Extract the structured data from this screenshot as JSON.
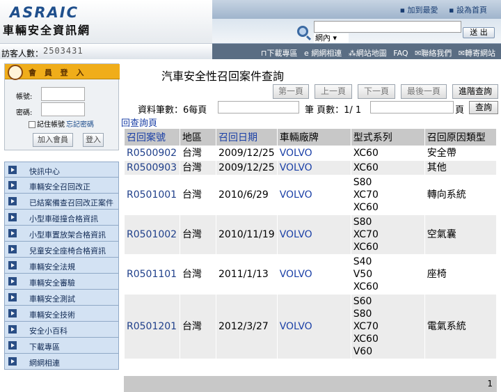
{
  "header": {
    "logo_en": "ASRAIC",
    "logo_zh": "車輛安全資訊網",
    "top_links": [
      "▪ 加到最愛",
      "▪ 設為首頁"
    ],
    "search_scope": "網內 ▾",
    "search_button": "送 出",
    "visitor_label": "訪客人數：",
    "visitor_count": "2503431",
    "nav_links": [
      "⊓下載專區",
      "e 網網相連",
      "⁂網站地圖",
      "FAQ",
      "✉聯絡我們",
      "✉轉寄網站"
    ]
  },
  "login": {
    "title": "會 員 登 入",
    "account_label": "帳號:",
    "password_label": "密碼:",
    "remember": "記住帳號",
    "forgot": "忘記密碼",
    "join_button": "加入會員",
    "login_button": "登入"
  },
  "menu": [
    "快訊中心",
    "車輛安全召回改正",
    "已結案備查召回改正案件",
    "小型車碰撞合格資訊",
    "小型車置放架合格資訊",
    "兒童安全座椅合格資訊",
    "車輛安全法規",
    "車輛安全審驗",
    "車輛安全測試",
    "車輛安全技術",
    "安全小百科",
    "下載專區",
    "網網相連"
  ],
  "main": {
    "title": "汽車安全性召回案件查詢",
    "buttons": {
      "first": "第一頁",
      "prev": "上一頁",
      "next": "下一頁",
      "last": "最後一頁",
      "advanced": "進階查詢"
    },
    "records_label": "資料筆數：6每頁",
    "pages_label": "筆 頁數：1/ 1",
    "page_suffix": "頁",
    "query_button": "查詢",
    "back_link": "回查詢頁",
    "columns": [
      "召回案號",
      "地區",
      "召回日期",
      "車輛廠牌",
      "型式系列",
      "召回原因類型"
    ],
    "rows": [
      {
        "id": "R0500902",
        "region": "台灣",
        "date": "2009/12/25",
        "brand": "VOLVO",
        "models": [
          "XC60"
        ],
        "reason": "安全帶"
      },
      {
        "id": "R0500903",
        "region": "台灣",
        "date": "2009/12/25",
        "brand": "VOLVO",
        "models": [
          "XC60"
        ],
        "reason": "其他"
      },
      {
        "id": "R0501001",
        "region": "台灣",
        "date": "2010/6/29",
        "brand": "VOLVO",
        "models": [
          "S80",
          "XC70",
          "XC60"
        ],
        "reason": "轉向系統"
      },
      {
        "id": "R0501002",
        "region": "台灣",
        "date": "2010/11/19",
        "brand": "VOLVO",
        "models": [
          "S80",
          "XC70",
          "XC60"
        ],
        "reason": "空氣囊"
      },
      {
        "id": "R0501101",
        "region": "台灣",
        "date": "2011/1/13",
        "brand": "VOLVO",
        "models": [
          "S40",
          "V50",
          "XC60"
        ],
        "reason": "座椅"
      },
      {
        "id": "R0501201",
        "region": "台灣",
        "date": "2012/3/27",
        "brand": "VOLVO",
        "models": [
          "S60",
          "S80",
          "XC70",
          "XC60",
          "V60"
        ],
        "reason": "電氣系統"
      }
    ],
    "page_number": "1"
  }
}
